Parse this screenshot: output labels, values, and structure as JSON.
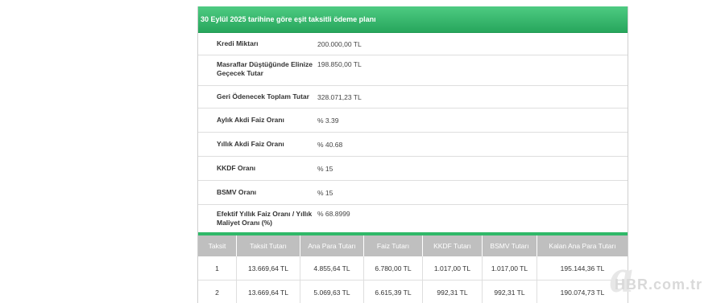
{
  "plan": {
    "title": "30 Eylül 2025 tarihine göre eşit taksitli ödeme planı",
    "info": [
      {
        "label": "Kredi Miktarı",
        "value": "200.000,00 TL"
      },
      {
        "label": "Masraflar Düştüğünde Elinize Geçecek Tutar",
        "value": "198.850,00 TL"
      },
      {
        "label": "Geri Ödenecek Toplam Tutar",
        "value": "328.071,23 TL"
      },
      {
        "label": "Aylık Akdi Faiz Oranı",
        "value": "% 3.39"
      },
      {
        "label": "Yıllık Akdi Faiz Oranı",
        "value": "% 40.68"
      },
      {
        "label": "KKDF Oranı",
        "value": "% 15"
      },
      {
        "label": "BSMV Oranı",
        "value": "% 15"
      },
      {
        "label": "Efektif Yıllık Faiz Oranı / Yıllık Maliyet Oranı (%)",
        "value": "% 68.8999"
      }
    ],
    "columns": [
      "Taksit",
      "Taksit Tutarı",
      "Ana Para Tutarı",
      "Faiz Tutarı",
      "KKDF Tutarı",
      "BSMV Tutarı",
      "Kalan Ana Para Tutarı"
    ],
    "rows": [
      [
        "1",
        "13.669,64 TL",
        "4.855,64 TL",
        "6.780,00 TL",
        "1.017,00 TL",
        "1.017,00 TL",
        "195.144,36 TL"
      ],
      [
        "2",
        "13.669,64 TL",
        "5.069,63 TL",
        "6.615,39 TL",
        "992,31 TL",
        "992,31 TL",
        "190.074,73 TL"
      ]
    ]
  },
  "watermark": {
    "logo_letter": "a",
    "text": "HBR.com.tr"
  }
}
